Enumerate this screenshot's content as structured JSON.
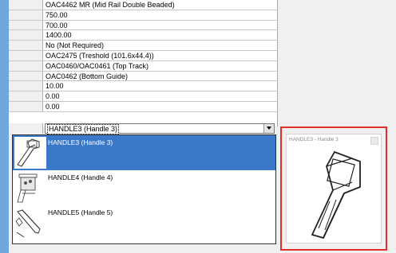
{
  "grid": {
    "rows": [
      {
        "value": "OAC4462 MR (Mid Rail Double Beaded)"
      },
      {
        "value": "750.00"
      },
      {
        "value": "700.00"
      },
      {
        "value": "1400.00"
      },
      {
        "value": "No (Not Required)"
      },
      {
        "value": "OAC2475 (Treshold (101.6x44.4))"
      },
      {
        "value": "OAC0460/OAC0461 (Top Track)"
      },
      {
        "value": "OAC0462 (Bottom Guide)"
      },
      {
        "value": "10.00"
      },
      {
        "value": "0.00"
      },
      {
        "value": "0.00"
      }
    ]
  },
  "combo": {
    "selected": "HANDLE3 (Handle 3)"
  },
  "dropdown": {
    "items": [
      {
        "label": "HANDLE3 (Handle 3)",
        "selected": true
      },
      {
        "label": "HANDLE4 (Handle 4)",
        "selected": false
      },
      {
        "label": "HANDLE5 (Handle 5)",
        "selected": false
      }
    ]
  },
  "preview": {
    "title": "HANDLE3 - Handle 3"
  },
  "colors": {
    "selection": "#3c78c8",
    "highlight_frame": "#e32c2c",
    "left_strip": "#6fa8dc"
  }
}
